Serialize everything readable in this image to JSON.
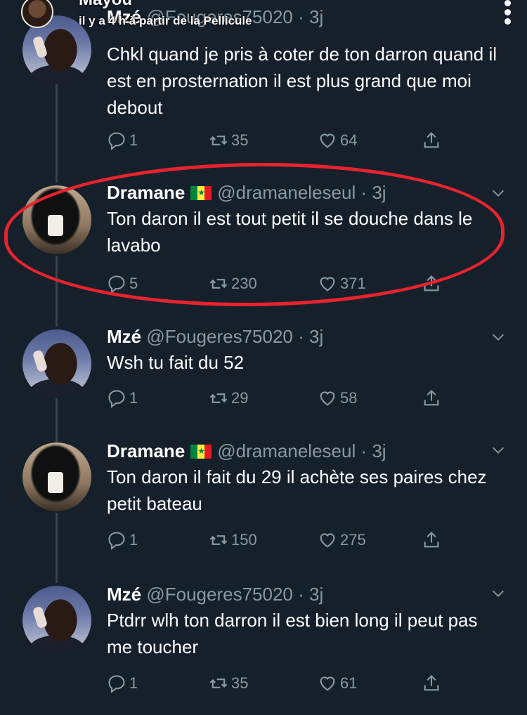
{
  "overlay": {
    "name": "Mayou",
    "subtitle": "il y a 4 h à partir de la Pellicule"
  },
  "tweets": [
    {
      "name": "Mzé",
      "handle": "@Fougeres75020",
      "time": "· 3j",
      "text": "Chkl quand je pris à coter de ton darron quand il est en prosternation il est plus grand que moi debout",
      "replies": "1",
      "retweets": "35",
      "likes": "64",
      "flag": false
    },
    {
      "name": "Dramane",
      "handle": "@dramaneleseul",
      "time": "· 3j",
      "text": "Ton daron il est tout petit il se douche dans le lavabo",
      "replies": "5",
      "retweets": "230",
      "likes": "371",
      "flag": true,
      "highlighted": true
    },
    {
      "name": "Mzé",
      "handle": "@Fougeres75020",
      "time": "· 3j",
      "text": "Wsh tu fait du 52",
      "replies": "1",
      "retweets": "29",
      "likes": "58",
      "flag": false
    },
    {
      "name": "Dramane",
      "handle": "@dramaneleseul",
      "time": "· 3j",
      "text": "Ton daron il fait du 29 il achète ses paires chez petit bateau",
      "replies": "1",
      "retweets": "150",
      "likes": "275",
      "flag": true
    },
    {
      "name": "Mzé",
      "handle": "@Fougeres75020",
      "time": "· 3j",
      "text": "Ptdrr wlh ton darron il est bien long il peut pas me toucher",
      "replies": "1",
      "retweets": "35",
      "likes": "61",
      "flag": false
    }
  ],
  "colors": {
    "background": "#15202b",
    "secondary_text": "#8899a6",
    "highlight_circle": "#e8232e"
  }
}
